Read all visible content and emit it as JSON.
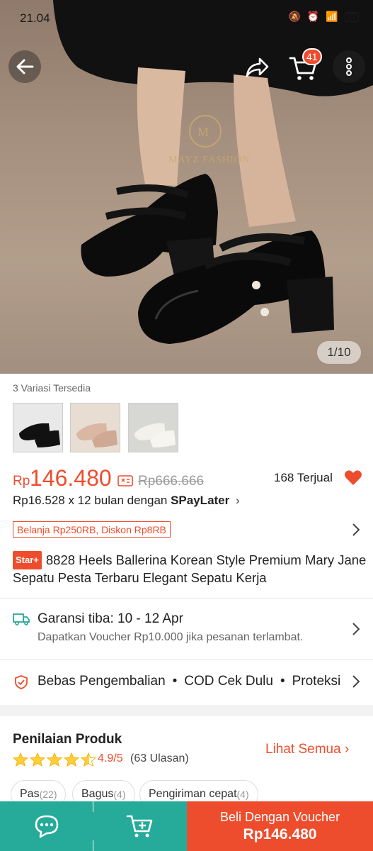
{
  "status_bar": {
    "time": "21.04",
    "battery": "77"
  },
  "header": {
    "cart_count": "41"
  },
  "image": {
    "watermark": "MAYZ FASHION",
    "counter": "1/10"
  },
  "variants": {
    "label": "3 Variasi Tersedia"
  },
  "price": {
    "currency": "Rp",
    "current": "146.480",
    "original": "Rp666.666",
    "sold": "168 Terjual",
    "installment_prefix": "Rp16.528 x 12 bulan dengan",
    "installment_brand": "SPayLater",
    "promo_tag": "Belanja Rp250RB, Diskon Rp8RB"
  },
  "product": {
    "badge": "Star+",
    "title": "8828 Heels Ballerina Korean Style Premium Mary Jane Sepatu Pesta Terbaru Elegant Sepatu Kerja"
  },
  "shipping": {
    "title": "Garansi tiba: 10 - 12 Apr",
    "subtitle": "Dapatkan Voucher Rp10.000 jika pesanan terlambat."
  },
  "features": {
    "f1": "Bebas Pengembalian",
    "f2": "COD Cek Dulu",
    "f3": "Proteksi"
  },
  "rating": {
    "title": "Penilaian Produk",
    "score": "4.9/5",
    "count": "(63 Ulasan)",
    "see_all": "Lihat Semua",
    "value": 4.9
  },
  "chips": [
    {
      "label": "Pas",
      "count": "(22)"
    },
    {
      "label": "Bagus",
      "count": "(4)"
    },
    {
      "label": "Pengiriman cepat",
      "count": "(4)"
    }
  ],
  "bottom_bar": {
    "buy_label": "Beli Dengan Voucher",
    "buy_price": "Rp146.480"
  },
  "colors": {
    "accent": "#ee4d2d",
    "teal": "#26aa99"
  }
}
